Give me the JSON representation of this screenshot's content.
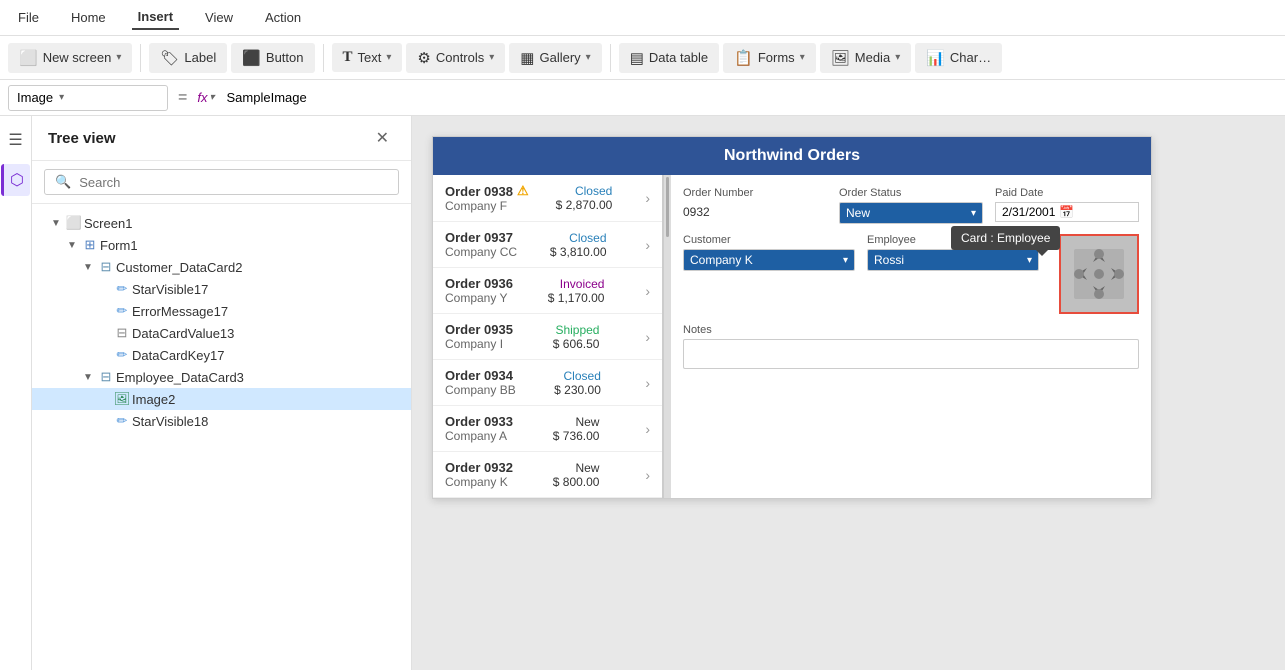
{
  "menu": {
    "items": [
      {
        "label": "File",
        "active": false
      },
      {
        "label": "Home",
        "active": false
      },
      {
        "label": "Insert",
        "active": true
      },
      {
        "label": "View",
        "active": false
      },
      {
        "label": "Action",
        "active": false
      }
    ]
  },
  "toolbar": {
    "buttons": [
      {
        "label": "New screen",
        "icon": "⬜",
        "hasChevron": true
      },
      {
        "label": "Label",
        "icon": "🏷",
        "hasChevron": false
      },
      {
        "label": "Button",
        "icon": "⬛",
        "hasChevron": false
      },
      {
        "label": "Text",
        "icon": "T",
        "hasChevron": true
      },
      {
        "label": "Controls",
        "icon": "⚙",
        "hasChevron": true
      },
      {
        "label": "Gallery",
        "icon": "▦",
        "hasChevron": true
      },
      {
        "label": "Data table",
        "icon": "▤",
        "hasChevron": false
      },
      {
        "label": "Forms",
        "icon": "📋",
        "hasChevron": true
      },
      {
        "label": "Media",
        "icon": "🖼",
        "hasChevron": true
      },
      {
        "label": "Char…",
        "icon": "📊",
        "hasChevron": false
      }
    ]
  },
  "formula_bar": {
    "selector_value": "Image",
    "fx_label": "fx",
    "equals": "=",
    "formula_value": "SampleImage"
  },
  "tree": {
    "title": "Tree view",
    "search_placeholder": "Search",
    "items": [
      {
        "id": "screen1",
        "label": "Screen1",
        "level": 0,
        "icon": "screen",
        "expanded": true
      },
      {
        "id": "form1",
        "label": "Form1",
        "level": 1,
        "icon": "form",
        "expanded": true
      },
      {
        "id": "customer_datacard2",
        "label": "Customer_DataCard2",
        "level": 2,
        "icon": "card",
        "expanded": true
      },
      {
        "id": "starvisible17",
        "label": "StarVisible17",
        "level": 3,
        "icon": "pencil"
      },
      {
        "id": "errormessage17",
        "label": "ErrorMessage17",
        "level": 3,
        "icon": "pencil"
      },
      {
        "id": "datacardvalue13",
        "label": "DataCardValue13",
        "level": 3,
        "icon": "input"
      },
      {
        "id": "datacardkey17",
        "label": "DataCardKey17",
        "level": 3,
        "icon": "pencil"
      },
      {
        "id": "employee_datacard3",
        "label": "Employee_DataCard3",
        "level": 2,
        "icon": "card",
        "expanded": true
      },
      {
        "id": "image2",
        "label": "Image2",
        "level": 3,
        "icon": "image",
        "selected": true
      },
      {
        "id": "starvisible18",
        "label": "StarVisible18",
        "level": 3,
        "icon": "pencil"
      }
    ]
  },
  "app": {
    "title": "Northwind Orders",
    "orders": [
      {
        "num": "Order 0938",
        "company": "Company F",
        "status": "Closed",
        "amount": "$ 2,870.00",
        "warn": true
      },
      {
        "num": "Order 0937",
        "company": "Company CC",
        "status": "Closed",
        "amount": "$ 3,810.00"
      },
      {
        "num": "Order 0936",
        "company": "Company Y",
        "status": "Invoiced",
        "amount": "$ 1,170.00"
      },
      {
        "num": "Order 0935",
        "company": "Company I",
        "status": "Shipped",
        "amount": "$ 606.50"
      },
      {
        "num": "Order 0934",
        "company": "Company BB",
        "status": "Closed",
        "amount": "$ 230.00"
      },
      {
        "num": "Order 0933",
        "company": "Company A",
        "status": "New",
        "amount": "$ 736.00"
      },
      {
        "num": "Order 0932",
        "company": "Company K",
        "status": "New",
        "amount": "$ 800.00"
      }
    ],
    "detail": {
      "order_number_label": "Order Number",
      "order_number_value": "0932",
      "order_status_label": "Order Status",
      "order_status_value": "New",
      "paid_date_label": "Paid Date",
      "paid_date_value": "2/31/2001",
      "customer_label": "Customer",
      "customer_value": "Company K",
      "employee_label": "Employee",
      "employee_value": "Rossi",
      "notes_label": "Notes",
      "notes_value": ""
    },
    "tooltip": "Card : Employee"
  }
}
